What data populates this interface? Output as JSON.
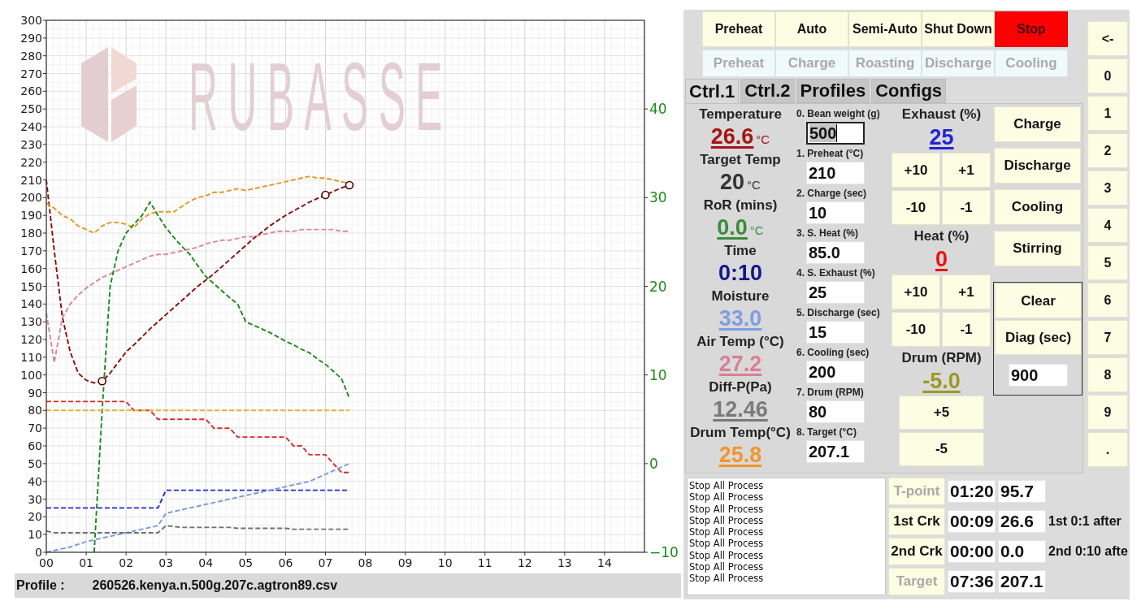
{
  "chart": {
    "logo_text": "RUBASSE",
    "chart_data": {
      "type": "line",
      "grid": true,
      "xlim": [
        0,
        15
      ],
      "ylim": [
        0,
        300
      ],
      "y2lim": [
        -10,
        50
      ],
      "xticks": [
        {
          "value": 0,
          "label": "00"
        },
        {
          "value": 1,
          "label": "01"
        },
        {
          "value": 2,
          "label": "02"
        },
        {
          "value": 3,
          "label": "03"
        },
        {
          "value": 4,
          "label": "04"
        },
        {
          "value": 5,
          "label": "05"
        },
        {
          "value": 6,
          "label": "06"
        },
        {
          "value": 7,
          "label": "07"
        },
        {
          "value": 8,
          "label": "08"
        },
        {
          "value": 9,
          "label": "09"
        },
        {
          "value": 10,
          "label": "10"
        },
        {
          "value": 11,
          "label": "11"
        },
        {
          "value": 12,
          "label": "12"
        },
        {
          "value": 13,
          "label": "13"
        },
        {
          "value": 14,
          "label": "14"
        }
      ],
      "yticks": [
        0,
        10,
        20,
        30,
        40,
        50,
        60,
        70,
        80,
        90,
        100,
        110,
        120,
        130,
        140,
        150,
        160,
        170,
        180,
        190,
        200,
        210,
        220,
        230,
        240,
        250,
        260,
        270,
        280,
        290,
        300
      ],
      "y2ticks": [
        {
          "value": -10,
          "label": "−10"
        },
        0,
        10,
        20,
        30,
        40
      ],
      "x": [
        0,
        0.2,
        0.4,
        0.6,
        0.8,
        1,
        1.2,
        1.4,
        1.6,
        1.8,
        2,
        2.2,
        2.4,
        2.6,
        2.8,
        3,
        3.2,
        3.4,
        3.6,
        3.8,
        4,
        4.2,
        4.4,
        4.6,
        4.8,
        5,
        5.2,
        5.4,
        5.6,
        5.8,
        6,
        6.2,
        6.4,
        6.6,
        6.8,
        7,
        7.2,
        7.4,
        7.6
      ],
      "series": [
        {
          "color": "#8b0a0a",
          "line_style": "dashed",
          "values": [
            210,
            170,
            133,
            113,
            101,
            97,
            95.5,
            96.5,
            101,
            107,
            113,
            117,
            121.5,
            126,
            130,
            134,
            138,
            142,
            146,
            150,
            153.5,
            157,
            161,
            165,
            169,
            173,
            177,
            180.5,
            184,
            187,
            190,
            192.5,
            195,
            197.5,
            199.5,
            201.5,
            203.5,
            205.5,
            207
          ]
        },
        {
          "color": "#e8951e",
          "line_style": "dashed",
          "values": [
            197,
            194,
            190,
            188,
            184,
            182,
            180,
            184,
            186,
            186,
            185,
            183,
            188,
            191,
            192,
            192,
            192,
            195,
            198,
            200,
            201,
            203,
            203,
            204,
            205,
            204,
            205,
            206,
            207,
            208,
            209,
            210,
            211,
            212,
            211,
            211,
            210,
            209,
            208
          ]
        },
        {
          "color": "#d9879c",
          "line_style": "dashed",
          "values": [
            135,
            107,
            132,
            140,
            145,
            149,
            152,
            155,
            157,
            159,
            161,
            163,
            165,
            167,
            168,
            168,
            169,
            170,
            171,
            172,
            174,
            175,
            176,
            176,
            177,
            178,
            178,
            179,
            180,
            181,
            181,
            181,
            182,
            182,
            182,
            182,
            182,
            181,
            181
          ]
        },
        {
          "color": "#1a8a1a",
          "line_style": "dashed",
          "axis": "y2",
          "values": [
            null,
            null,
            null,
            null,
            null,
            null,
            -10,
            6,
            20,
            24,
            26,
            27,
            28,
            29.5,
            28,
            26.6,
            25.5,
            24.5,
            23.6,
            22.3,
            21.1,
            20.3,
            19.5,
            18.7,
            18,
            16,
            15.6,
            15.2,
            14.8,
            14.3,
            13.8,
            13.4,
            12.9,
            12.5,
            11.8,
            11.2,
            10.4,
            9.6,
            7.4
          ]
        },
        {
          "color": "#dd2a2a",
          "line_style": "dashed",
          "values": [
            85,
            85,
            85,
            85,
            85,
            85,
            85,
            85,
            85,
            85,
            85,
            80,
            80,
            80,
            75,
            75,
            75,
            75,
            75,
            75,
            75,
            70,
            70,
            70,
            65,
            65,
            65,
            65,
            65,
            65,
            65,
            60,
            60,
            55,
            55,
            55,
            50,
            45,
            45
          ]
        },
        {
          "color": "#e0b43a",
          "line_style": "dashed",
          "values": [
            80,
            80,
            80,
            80,
            80,
            80,
            80,
            80,
            80,
            80,
            80,
            80,
            80,
            80,
            80,
            80,
            80,
            80,
            80,
            80,
            80,
            80,
            80,
            80,
            80,
            80,
            80,
            80,
            80,
            80,
            80,
            80,
            80,
            80,
            80,
            80,
            80,
            80,
            80
          ]
        },
        {
          "color": "#1f2ad0",
          "line_style": "dashed",
          "values": [
            25,
            25,
            25,
            25,
            25,
            25,
            25,
            25,
            25,
            25,
            25,
            25,
            25,
            25,
            25,
            35,
            35,
            35,
            35,
            35,
            35,
            35,
            35,
            35,
            35,
            35,
            35,
            35,
            35,
            35,
            35,
            35,
            35,
            35,
            35,
            35,
            35,
            35,
            35
          ]
        },
        {
          "color": "#7b98e0",
          "line_style": "dashed",
          "values": [
            0,
            1,
            2,
            3,
            4.5,
            6,
            7,
            8,
            9,
            10,
            11,
            12,
            13,
            14,
            15,
            22,
            23,
            24,
            25,
            26,
            27,
            28,
            29,
            30,
            31,
            32,
            33,
            34,
            35,
            36,
            37,
            38,
            39,
            40,
            42,
            44,
            46,
            48,
            50
          ]
        },
        {
          "color": "#707070",
          "line_style": "dashed",
          "values": [
            12,
            11,
            11,
            11,
            11,
            11,
            11,
            11,
            11,
            11,
            11,
            11,
            11,
            11,
            11,
            15,
            14.5,
            14,
            14,
            14,
            14,
            14,
            14,
            14,
            13.5,
            13.5,
            13.5,
            13.5,
            13.5,
            13.5,
            13.5,
            13,
            13,
            13,
            13,
            13,
            13,
            13,
            13
          ]
        },
        {
          "color": "#4a0000",
          "type": "scatter",
          "marker": "circle",
          "values": [
            null,
            null,
            null,
            null,
            null,
            null,
            null,
            96.5,
            null,
            null,
            null,
            null,
            null,
            null,
            null,
            null,
            null,
            null,
            null,
            null,
            null,
            null,
            null,
            null,
            null,
            null,
            null,
            null,
            null,
            null,
            null,
            null,
            null,
            null,
            null,
            201.5,
            null,
            null,
            207
          ]
        }
      ]
    }
  },
  "profile_bar": {
    "label": "Profile :",
    "file": "260526.kenya.n.500g.207c.agtron89.csv"
  },
  "mode_buttons": [
    {
      "label": "Preheat",
      "kind": "normal"
    },
    {
      "label": "Auto",
      "kind": "normal"
    },
    {
      "label": "Semi-Auto",
      "kind": "normal"
    },
    {
      "label": "Shut Down",
      "kind": "normal"
    },
    {
      "label": "Stop",
      "kind": "stop"
    }
  ],
  "phase_indicators": [
    {
      "label": "Preheat",
      "disabled": true
    },
    {
      "label": "Charge",
      "disabled": true
    },
    {
      "label": "Roasting",
      "disabled": true
    },
    {
      "label": "Discharge",
      "disabled": true
    },
    {
      "label": "Cooling",
      "disabled": true
    }
  ],
  "tabs": [
    {
      "label": "Ctrl.1",
      "selected": true
    },
    {
      "label": "Ctrl.2",
      "selected": false
    },
    {
      "label": "Profiles",
      "selected": false
    },
    {
      "label": "Configs",
      "selected": false
    }
  ],
  "readings": [
    {
      "label": "Temperature",
      "value": "26.6",
      "unit": "°C",
      "color": "#a31515",
      "underlined": true
    },
    {
      "label": "Target Temp",
      "value": "20",
      "unit": "°C",
      "color": "#333333",
      "underlined": false
    },
    {
      "label": "RoR (mins)",
      "value": "0.0",
      "unit": "°C",
      "color": "#3c8c3c",
      "underlined": true
    },
    {
      "label": "Time",
      "value": "0:10",
      "color": "#16168a",
      "underlined": false
    },
    {
      "label": "Moisture",
      "value": "33.0",
      "color": "#7f9de3",
      "underlined": true
    },
    {
      "label": "Air Temp (°C)",
      "value": "27.2",
      "color": "#d97f98",
      "underlined": true
    },
    {
      "label": "Diff-P(Pa)",
      "value": "12.46",
      "color": "#7a7a7a",
      "underlined": true
    },
    {
      "label": "Drum Temp(°C)",
      "value": "25.8",
      "color": "#f0962a",
      "underlined": true
    }
  ],
  "parameters": [
    {
      "label": "0. Bean weight (g)",
      "value": "500",
      "focused": true
    },
    {
      "label": "1. Preheat (°C)",
      "value": "210",
      "focused": false
    },
    {
      "label": "2. Charge (sec)",
      "value": "10",
      "focused": false
    },
    {
      "label": "3. S. Heat (%)",
      "value": "85.0",
      "focused": false
    },
    {
      "label": "4. S. Exhaust (%)",
      "value": "25",
      "focused": false
    },
    {
      "label": "5. Discharge (sec)",
      "value": "15",
      "focused": false
    },
    {
      "label": "6. Cooling (sec)",
      "value": "200",
      "focused": false
    },
    {
      "label": "7. Drum (RPM)",
      "value": "80",
      "focused": false
    },
    {
      "label": "8. Target (°C)",
      "value": "207.1",
      "focused": false
    }
  ],
  "adjusters": [
    {
      "label": "Exhaust (%)",
      "value": "25",
      "color": "#2323d6",
      "kind": "grid",
      "buttons": [
        "+10",
        "+1",
        "-10",
        "-1"
      ]
    },
    {
      "label": "Heat (%)",
      "value": "0",
      "color": "#ee1111",
      "kind": "grid",
      "buttons": [
        "+10",
        "+1",
        "-10",
        "-1"
      ]
    },
    {
      "label": "Drum (RPM)",
      "value": "-5.0",
      "color": "#999a1e",
      "kind": "stack",
      "buttons": [
        "+5",
        "-5"
      ]
    }
  ],
  "action_buttons": [
    "Charge",
    "Discharge",
    "Cooling",
    "Stirring"
  ],
  "diagnostics": {
    "clear_label": "Clear",
    "diag_label": "Diag (sec)",
    "value": "900"
  },
  "keypad": [
    "<-",
    "0",
    "1",
    "2",
    "3",
    "4",
    "5",
    "6",
    "7",
    "8",
    "9",
    "."
  ],
  "log": [
    "Stop All Process",
    "Stop All Process",
    "Stop All Process",
    "Stop All Process",
    "Stop All Process",
    "Stop All Process",
    "Stop All Process",
    "Stop All Process",
    "Stop All Process"
  ],
  "events": [
    {
      "label": "T-point",
      "disabled": true,
      "time": "01:20",
      "value": "95.7"
    },
    {
      "label": "1st Crk",
      "disabled": false,
      "time": "00:09",
      "value": "26.6",
      "note": "1st 0:1 after"
    },
    {
      "label": "2nd Crk",
      "disabled": false,
      "time": "00:00",
      "value": "0.0",
      "note": "2nd 0:10 afte"
    },
    {
      "label": "Target",
      "disabled": true,
      "time": "07:36",
      "value": "207.1"
    }
  ]
}
